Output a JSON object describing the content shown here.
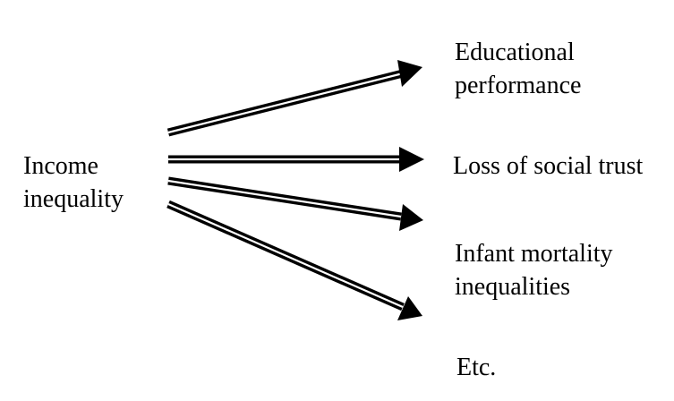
{
  "source": {
    "lines": [
      "Income",
      "inequality"
    ]
  },
  "targets": [
    {
      "lines": [
        "Educational",
        "performance"
      ]
    },
    {
      "lines": [
        "Loss of social trust"
      ]
    },
    {
      "lines": [
        "Infant mortality",
        "inequalities"
      ]
    },
    {
      "lines": [
        "Etc."
      ]
    }
  ],
  "colors": {
    "ink": "#000000",
    "background": "#ffffff"
  }
}
